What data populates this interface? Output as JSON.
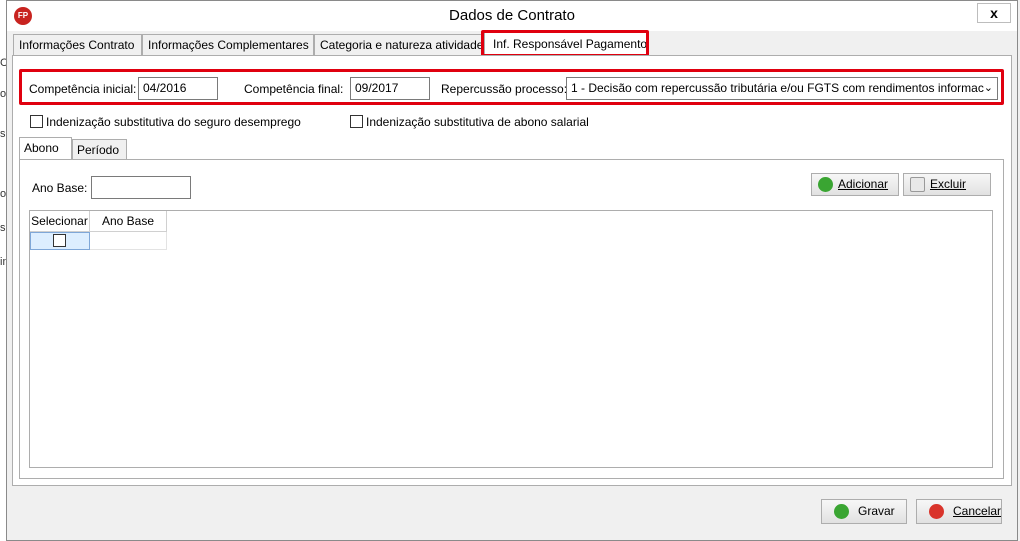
{
  "background": {
    "fragments": [
      "C",
      "o",
      "s",
      "b",
      "o",
      "in"
    ]
  },
  "window": {
    "title": "Dados de Contrato",
    "icon_text": "FP",
    "close_label": "x"
  },
  "tabs": [
    {
      "label": "Informações Contrato"
    },
    {
      "label": "Informações Complementares"
    },
    {
      "label": "Categoria e natureza atividade"
    },
    {
      "label": "Inf. Responsável Pagamento"
    }
  ],
  "form": {
    "competencia_inicial_label": "Competência inicial:",
    "competencia_inicial_value": "04/2016",
    "competencia_final_label": "Competência final:",
    "competencia_final_value": "09/2017",
    "repercussao_label": "Repercussão processo:",
    "repercussao_value": "1 - Decisão com repercussão tributária e/ou FGTS com rendimentos informac",
    "indenizacao_seguro_label": "Indenização substitutiva do seguro desemprego",
    "indenizacao_abono_label": "Indenização substitutiva de abono salarial"
  },
  "subtabs": [
    {
      "label": "Abono"
    },
    {
      "label": "Período"
    }
  ],
  "abono": {
    "ano_base_label": "Ano Base:",
    "ano_base_value": "",
    "adicionar_label": "Adicionar",
    "excluir_label": "Excluir",
    "grid_headers": [
      "Selecionar",
      "Ano Base"
    ]
  },
  "footer": {
    "gravar_label": "Gravar",
    "cancelar_label": "Cancelar"
  },
  "colors": {
    "highlight": "#e0000f",
    "add_icon": "#3aa532",
    "cancel_icon": "#d9342b"
  }
}
